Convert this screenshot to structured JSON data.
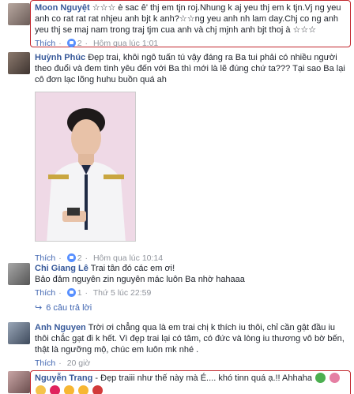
{
  "comments": [
    {
      "name": "Moon Nguyệt",
      "text": "☆☆☆ è sac ê' thj em tjn roj.Nhung k aj yeu thj em k tjn.Vj ng yeu anh co rat rat rat nhjeu anh bjt k anh?☆☆ng yeu anh nh lam day.Chj co ng anh yeu thj se maj nam trong traj tjm cua anh và chj mjnh anh bjt thoj à ☆☆☆",
      "like": "Thích",
      "likes": "2",
      "time": "Hôm qua lúc 1:01"
    },
    {
      "name": "Huỳnh Phúc",
      "text": "Đẹp trai, khôi ngô tuấn tú vậy đáng ra Ba tui phải có nhiều người theo đuổi và đem tình yêu đến với Ba thì mới là lẽ đúng chứ ta??? Tại sao Ba lại cô đơn lạc lõng huhu buồn quá ah",
      "like": "Thích",
      "likes": "2",
      "time": "Hôm qua lúc 10:14"
    },
    {
      "name": "Chi Giang Lê",
      "text": "Trai tân đó các em ơi!\nBảo đảm nguyên zin nguyên mác luôn Ba nhờ hahaaa",
      "like": "Thích",
      "likes": "1",
      "time": "Thứ 5 lúc 22:59"
    },
    {
      "name": "Anh Nguyen",
      "text": "Trời ơi chẳng qua là em trai chị k thích iu thôi, chỉ cần gật đầu iu thôi chắc gạt đi k hết. Vì đẹp trai lại có tâm, có đức và lòng iu thương vô bờ bến, thật là ngưỡng mộ, chúc em luôn mk nhé .",
      "like": "Thích",
      "time": "20 giờ"
    },
    {
      "name": "Nguyễn Trang",
      "text": "- Đẹp traiii như thế này mà É.... khó tinn quá ạ.!! Ahhaha"
    }
  ],
  "replies_link": "6 câu trả lời"
}
